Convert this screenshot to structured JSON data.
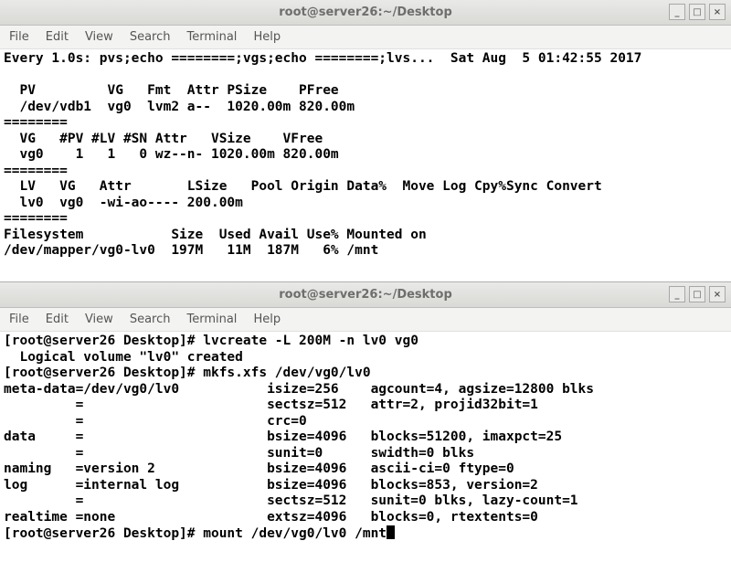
{
  "window1": {
    "title": "root@server26:~/Desktop",
    "menu": [
      "File",
      "Edit",
      "View",
      "Search",
      "Terminal",
      "Help"
    ],
    "controls": {
      "min": "_",
      "max": "□",
      "close": "×"
    },
    "lines": [
      "Every 1.0s: pvs;echo ========;vgs;echo ========;lvs...  Sat Aug  5 01:42:55 2017",
      "",
      "  PV         VG   Fmt  Attr PSize    PFree",
      "  /dev/vdb1  vg0  lvm2 a--  1020.00m 820.00m",
      "========",
      "  VG   #PV #LV #SN Attr   VSize    VFree",
      "  vg0    1   1   0 wz--n- 1020.00m 820.00m",
      "========",
      "  LV   VG   Attr       LSize   Pool Origin Data%  Move Log Cpy%Sync Convert",
      "  lv0  vg0  -wi-ao---- 200.00m",
      "========",
      "Filesystem           Size  Used Avail Use% Mounted on",
      "/dev/mapper/vg0-lv0  197M   11M  187M   6% /mnt"
    ]
  },
  "window2": {
    "title": "root@server26:~/Desktop",
    "menu": [
      "File",
      "Edit",
      "View",
      "Search",
      "Terminal",
      "Help"
    ],
    "controls": {
      "min": "_",
      "max": "□",
      "close": "×"
    },
    "lines": [
      "[root@server26 Desktop]# lvcreate -L 200M -n lv0 vg0",
      "  Logical volume \"lv0\" created",
      "[root@server26 Desktop]# mkfs.xfs /dev/vg0/lv0",
      "meta-data=/dev/vg0/lv0           isize=256    agcount=4, agsize=12800 blks",
      "         =                       sectsz=512   attr=2, projid32bit=1",
      "         =                       crc=0",
      "data     =                       bsize=4096   blocks=51200, imaxpct=25",
      "         =                       sunit=0      swidth=0 blks",
      "naming   =version 2              bsize=4096   ascii-ci=0 ftype=0",
      "log      =internal log           bsize=4096   blocks=853, version=2",
      "         =                       sectsz=512   sunit=0 blks, lazy-count=1",
      "realtime =none                   extsz=4096   blocks=0, rtextents=0"
    ],
    "prompt_line": "[root@server26 Desktop]# mount /dev/vg0/lv0 /mnt"
  }
}
